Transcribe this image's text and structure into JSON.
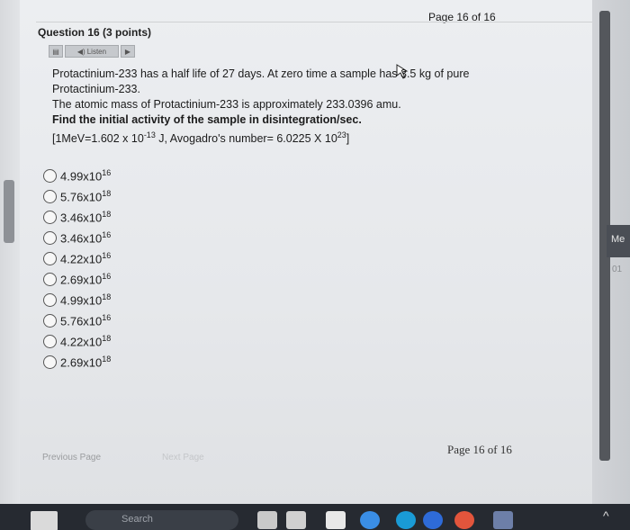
{
  "header": {
    "page_indicator_top": "Page 16 of 16",
    "question_title": "Question 16 (3 points)"
  },
  "toolbar": {
    "listen_label": "Listen"
  },
  "question": {
    "line1": "Protactinium-233 has a half life of 27 days. At zero time a sample has 3.5 kg of pure",
    "line2": "Protactinium-233.",
    "line3": "The atomic mass of Protactinium-233 is approximately 233.0396 amu.",
    "line4": "Find the initial activity of the sample in disintegration/sec.",
    "line5_a": "[1MeV=1.602 x 10",
    "line5_exp1": "-13",
    "line5_b": " J, Avogadro's number= 6.0225 X 10",
    "line5_exp2": "23",
    "line5_c": "]"
  },
  "options": [
    {
      "base": "4.99x10",
      "exp": "16"
    },
    {
      "base": "5.76x10",
      "exp": "18"
    },
    {
      "base": "3.46x10",
      "exp": "18"
    },
    {
      "base": "3.46x10",
      "exp": "16"
    },
    {
      "base": "4.22x10",
      "exp": "16"
    },
    {
      "base": "2.69x10",
      "exp": "16"
    },
    {
      "base": "4.99x10",
      "exp": "18"
    },
    {
      "base": "5.76x10",
      "exp": "16"
    },
    {
      "base": "4.22x10",
      "exp": "18"
    },
    {
      "base": "2.69x10",
      "exp": "18"
    }
  ],
  "footer": {
    "previous_page": "Previous Page",
    "next_page": "Next Page",
    "page_indicator_bottom": "Page 16 of 16"
  },
  "side_panel": {
    "tab_label": "Me",
    "tab_sub": "01"
  },
  "taskbar": {
    "search_label": "Search"
  }
}
